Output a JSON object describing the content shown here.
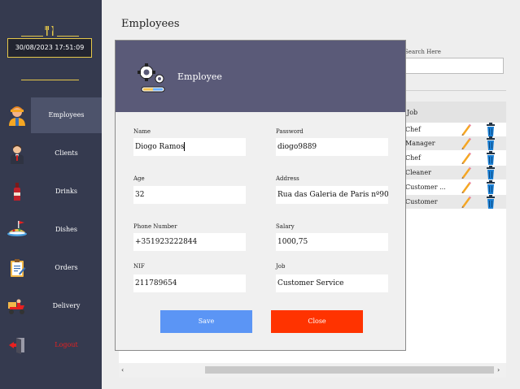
{
  "app": {
    "clock": "30/08/2023 17:51:09"
  },
  "sidebar": {
    "items": [
      {
        "label": "Employees",
        "icon": "employee-icon",
        "active": true
      },
      {
        "label": "Clients",
        "icon": "client-icon",
        "active": false
      },
      {
        "label": "Drinks",
        "icon": "drink-bottle-icon",
        "active": false
      },
      {
        "label": "Dishes",
        "icon": "dish-icon",
        "active": false
      },
      {
        "label": "Orders",
        "icon": "clipboard-icon",
        "active": false
      },
      {
        "label": "Delivery",
        "icon": "delivery-scooter-icon",
        "active": false
      },
      {
        "label": "Logout",
        "icon": "door-exit-icon",
        "active": false
      }
    ]
  },
  "main": {
    "title": "Employees",
    "search": {
      "label": "Search Here",
      "value": ""
    },
    "table": {
      "columns": [
        "Job"
      ],
      "rows": [
        {
          "job": "Chef"
        },
        {
          "job": "Manager"
        },
        {
          "job": "Chef"
        },
        {
          "job": "Cleaner"
        },
        {
          "job": "Customer ..."
        },
        {
          "job": "Customer"
        }
      ]
    },
    "scroll": {
      "left": "‹",
      "right": "›"
    }
  },
  "modal": {
    "title": "Employee",
    "icon": "gears-icon",
    "fields": {
      "name": {
        "label": "Name",
        "value": "Diogo Ramos"
      },
      "password": {
        "label": "Password",
        "value": "diogo9889"
      },
      "age": {
        "label": "Age",
        "value": "32"
      },
      "address": {
        "label": "Address",
        "value": "Rua das Galeria de Paris nº90"
      },
      "phone": {
        "label": "Phone Number",
        "value": "+351923222844"
      },
      "salary": {
        "label": "Salary",
        "value": "1000,75"
      },
      "nif": {
        "label": "NIF",
        "value": "211789654"
      },
      "job": {
        "label": "Job",
        "value": "Customer Service"
      }
    },
    "buttons": {
      "save": "Save",
      "close": "Close"
    }
  },
  "colors": {
    "sidebar": "#353a4f",
    "sidebar_active": "#4d536b",
    "accent_gold": "#e6c84a",
    "modal_header": "#5a5a78",
    "save": "#5b95f5",
    "close": "#ff3300",
    "logout": "#e82020"
  }
}
